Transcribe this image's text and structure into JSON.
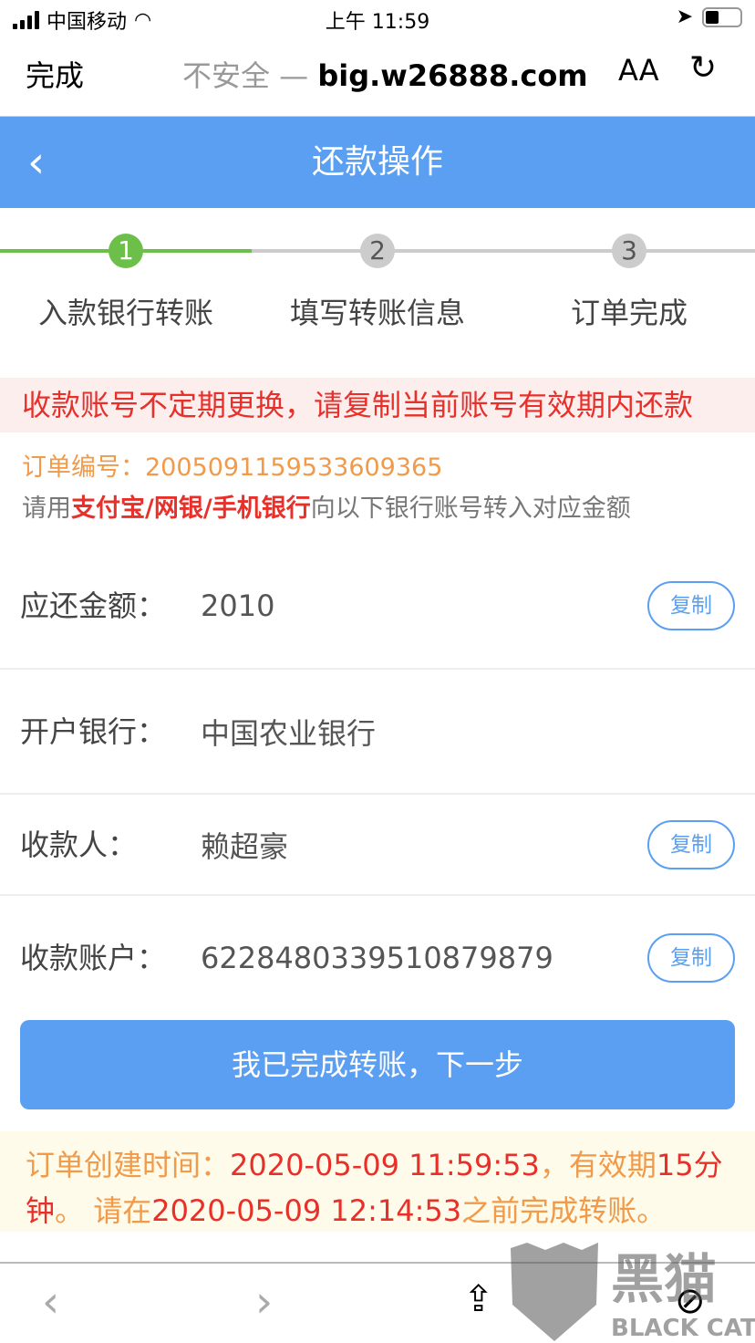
{
  "status": {
    "carrier": "中国移动",
    "time": "上午 11:59"
  },
  "browser": {
    "done": "完成",
    "security": "不安全 — ",
    "domain": "big.w26888.com",
    "text_size": "AA",
    "reload_icon": "reload-icon"
  },
  "header": {
    "title": "还款操作",
    "back_icon": "chevron-left-icon"
  },
  "steps": [
    {
      "num": "1",
      "label": "入款银行转账",
      "active": true
    },
    {
      "num": "2",
      "label": "填写转账信息",
      "active": false
    },
    {
      "num": "3",
      "label": "订单完成",
      "active": false
    }
  ],
  "notice": "收款账号不定期更换，请复制当前账号有效期内还款",
  "order": {
    "label": "订单编号：",
    "number": "2005091159533609365",
    "hint_pre": "请用",
    "hint_methods": "支付宝/网银/手机银行",
    "hint_post": "向以下银行账号转入对应金额"
  },
  "fields": [
    {
      "label": "应还金额：",
      "value": "2010",
      "copy": "复制"
    },
    {
      "label": "开户银行：",
      "value": "中国农业银行"
    },
    {
      "label": "收款人：",
      "value": "赖超豪",
      "copy": "复制"
    },
    {
      "label": "收款账户：",
      "value": "6228480339510879879",
      "copy": "复制"
    }
  ],
  "next_button": "我已完成转账，下一步",
  "info": {
    "p1": "订单创建时间：",
    "created": "2020-05-09 11:59:53",
    "p2": "，有效期",
    "minutes": "15",
    "p3": "分钟",
    "p4": "。 请在",
    "deadline": "2020-05-09 12:14:53",
    "p5": "之前完成转账。"
  },
  "watermark": {
    "cn": "黑猫",
    "en": "BLACK CAT"
  },
  "colors": {
    "accent": "#5a9ff2",
    "step_active": "#6cc04a",
    "warning": "#e8302a",
    "orange": "#f09a4a"
  }
}
